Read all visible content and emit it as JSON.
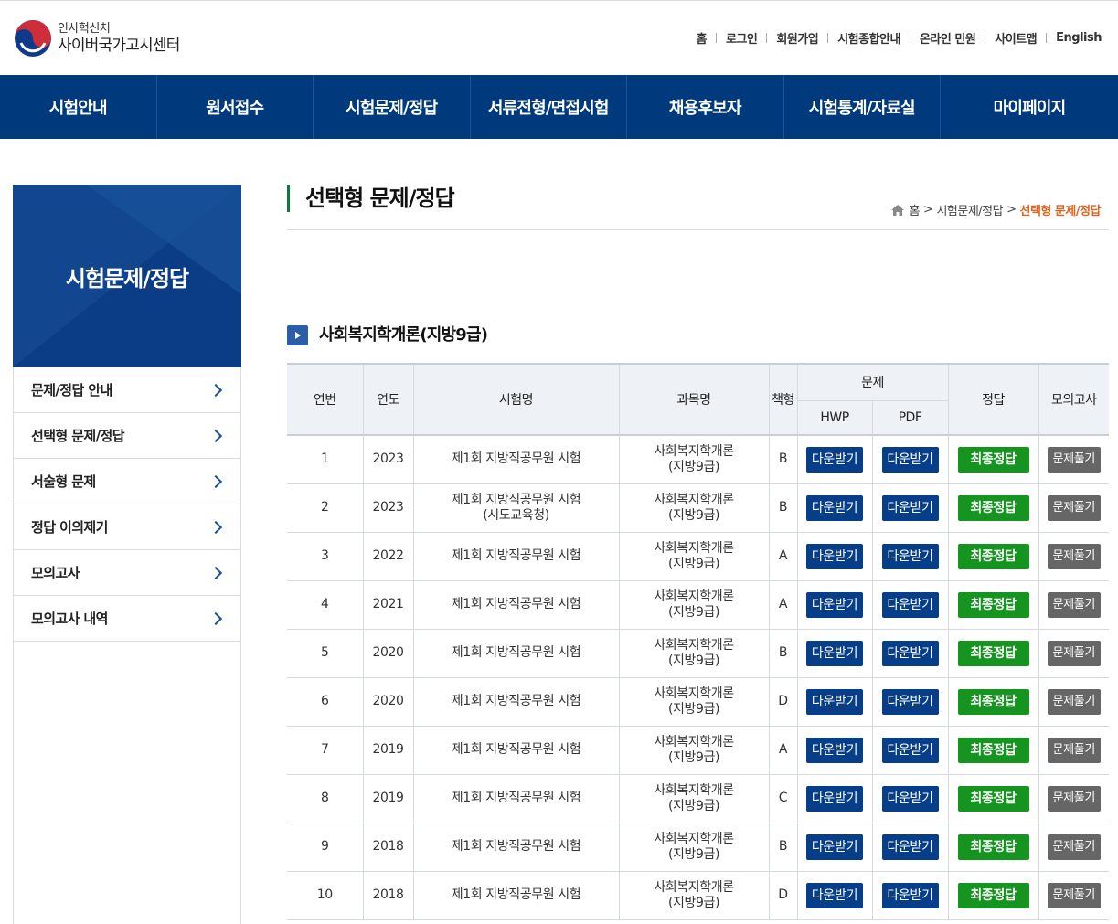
{
  "header": {
    "org_sub": "인사혁신처",
    "org_main": "사이버국가고시센터",
    "util_links": [
      "홈",
      "로그인",
      "회원가입",
      "시험종합안내",
      "온라인 민원",
      "사이트맵",
      "English"
    ]
  },
  "gnb": [
    "시험안내",
    "원서접수",
    "시험문제/정답",
    "서류전형/면접시험",
    "채용후보자",
    "시험통계/자료실",
    "마이페이지"
  ],
  "sidebar": {
    "title": "시험문제/정답",
    "items": [
      "문제/정답 안내",
      "선택형 문제/정답",
      "서술형 문제",
      "정답 이의제기",
      "모의고사",
      "모의고사 내역"
    ]
  },
  "page": {
    "title": "선택형 문제/정답",
    "breadcrumb": {
      "home": "홈",
      "parent": "시험문제/정답",
      "current": "선택형 문제/정답",
      "sep": ">"
    }
  },
  "section": {
    "title": "사회복지학개론(지방9급)"
  },
  "table": {
    "headers": {
      "no": "연번",
      "year": "연도",
      "exam": "시험명",
      "subject": "과목명",
      "type": "책형",
      "question": "문제",
      "hwp": "HWP",
      "pdf": "PDF",
      "answer": "정답",
      "mock": "모의고사"
    },
    "buttons": {
      "download": "다운받기",
      "final_answer": "최종정답",
      "solve": "문제풀기"
    },
    "rows": [
      {
        "no": "1",
        "year": "2023",
        "exam": "제1회 지방직공무원 시험",
        "exam2": "",
        "subject": "사회복지학개론",
        "subject2": "(지방9급)",
        "type": "B"
      },
      {
        "no": "2",
        "year": "2023",
        "exam": "제1회 지방직공무원 시험",
        "exam2": "(시도교육청)",
        "subject": "사회복지학개론",
        "subject2": "(지방9급)",
        "type": "B"
      },
      {
        "no": "3",
        "year": "2022",
        "exam": "제1회 지방직공무원 시험",
        "exam2": "",
        "subject": "사회복지학개론",
        "subject2": "(지방9급)",
        "type": "A"
      },
      {
        "no": "4",
        "year": "2021",
        "exam": "제1회 지방직공무원 시험",
        "exam2": "",
        "subject": "사회복지학개론",
        "subject2": "(지방9급)",
        "type": "A"
      },
      {
        "no": "5",
        "year": "2020",
        "exam": "제1회 지방직공무원 시험",
        "exam2": "",
        "subject": "사회복지학개론",
        "subject2": "(지방9급)",
        "type": "B"
      },
      {
        "no": "6",
        "year": "2020",
        "exam": "제1회 지방직공무원 시험",
        "exam2": "",
        "subject": "사회복지학개론",
        "subject2": "(지방9급)",
        "type": "D"
      },
      {
        "no": "7",
        "year": "2019",
        "exam": "제1회 지방직공무원 시험",
        "exam2": "",
        "subject": "사회복지학개론",
        "subject2": "(지방9급)",
        "type": "A"
      },
      {
        "no": "8",
        "year": "2019",
        "exam": "제1회 지방직공무원 시험",
        "exam2": "",
        "subject": "사회복지학개론",
        "subject2": "(지방9급)",
        "type": "C"
      },
      {
        "no": "9",
        "year": "2018",
        "exam": "제1회 지방직공무원 시험",
        "exam2": "",
        "subject": "사회복지학개론",
        "subject2": "(지방9급)",
        "type": "B"
      },
      {
        "no": "10",
        "year": "2018",
        "exam": "제1회 지방직공무원 시험",
        "exam2": "",
        "subject": "사회복지학개론",
        "subject2": "(지방9급)",
        "type": "D"
      }
    ]
  },
  "colors": {
    "gnb": "#003a7d",
    "download": "#063e8a",
    "final_answer": "#15941f",
    "solve": "#666666",
    "breadcrumb_current": "#e2621b",
    "title_bar": "#0e7a3c"
  },
  "icons": {
    "logo": "taegeuk-logo-icon",
    "home": "home-icon",
    "chevron": "chevron-right-icon",
    "section": "play-square-icon"
  }
}
